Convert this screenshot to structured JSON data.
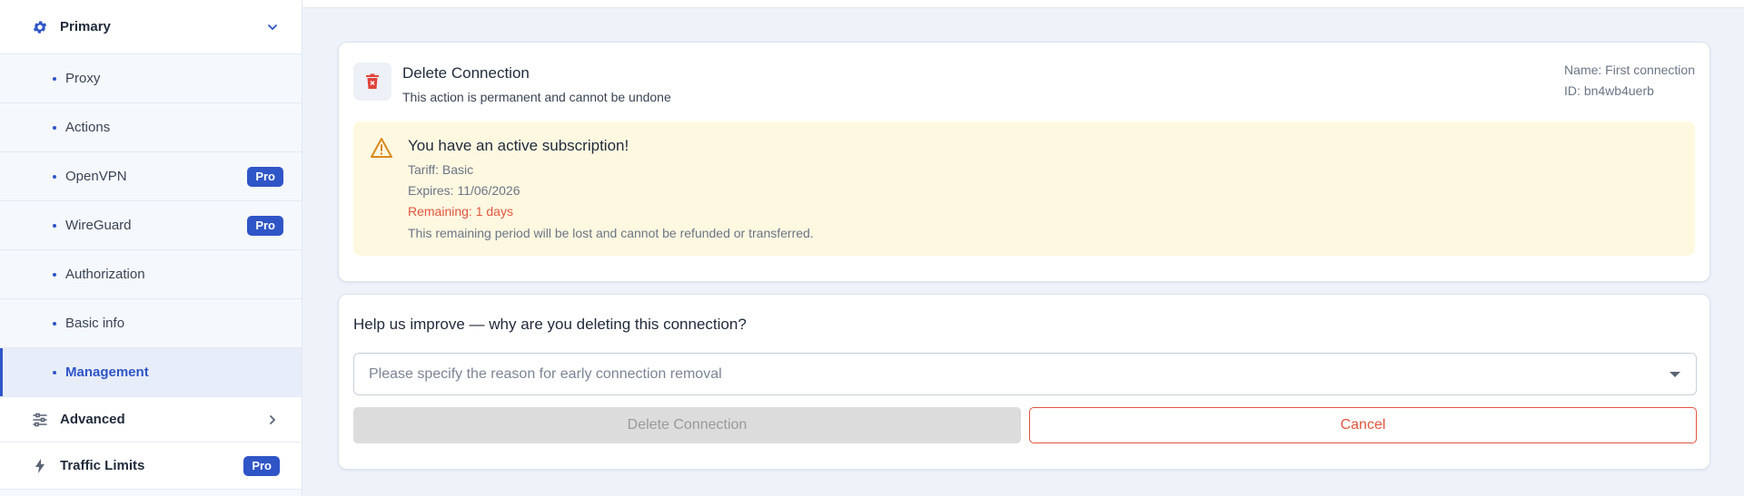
{
  "sidebar": {
    "primary": {
      "label": "Primary",
      "icon": "gear-icon"
    },
    "items": [
      {
        "label": "Proxy"
      },
      {
        "label": "Actions"
      },
      {
        "label": "OpenVPN",
        "badge": "Pro"
      },
      {
        "label": "WireGuard",
        "badge": "Pro"
      },
      {
        "label": "Authorization"
      },
      {
        "label": "Basic info"
      },
      {
        "label": "Management",
        "active": true
      }
    ],
    "advanced": {
      "label": "Advanced",
      "icon": "sliders-icon"
    },
    "traffic": {
      "label": "Traffic Limits",
      "icon": "bolt-icon",
      "badge": "Pro"
    }
  },
  "delete_card": {
    "title": "Delete Connection",
    "subtitle": "This action is permanent and cannot be undone",
    "name": "Name: First connection",
    "id": "ID: bn4wb4uerb",
    "warning": {
      "title": "You have an active subscription!",
      "tariff": "Tariff: Basic",
      "expires": "Expires: 11/06/2026",
      "remaining": "Remaining: 1 days",
      "note": "This remaining period will be lost and cannot be refunded or transferred."
    }
  },
  "feedback": {
    "question": "Help us improve — why are you deleting this connection?",
    "placeholder": "Please specify the reason for early connection removal",
    "delete_label": "Delete Connection",
    "cancel_label": "Cancel"
  },
  "colors": {
    "accent": "#2f55c7",
    "danger": "#e0553e",
    "warning_bg": "#fff8e1"
  }
}
